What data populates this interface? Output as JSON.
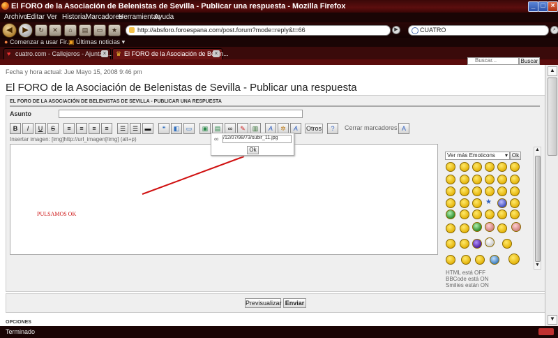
{
  "window": {
    "title": "El FORO de la Asociación de Belenistas de Sevilla - Publicar una respuesta - Mozilla Firefox",
    "controls": [
      "_",
      "□",
      "×"
    ]
  },
  "menu": [
    "Archivo",
    "Editar",
    "Ver",
    "Historial",
    "Marcadores",
    "Herramientas",
    "Ayuda"
  ],
  "nav": {
    "url": "http://absforo.foroespana.com/post.forum?mode=reply&t=66",
    "search_value": "CUATRO"
  },
  "bookmarks": [
    "Comenzar a usar Fir...",
    "Últimas noticias"
  ],
  "tabs": [
    {
      "label": "cuatro.com - Callejeros - Ajuntam...",
      "active": false
    },
    {
      "label": "El FORO de la Asociación de Belen...",
      "active": true
    }
  ],
  "page": {
    "search_placeholder": "Buscar...",
    "search_button": "Buscar",
    "date_line": "Fecha y hora actual: Jue Mayo 15, 2008 9:46 pm",
    "heading": "El FORO de la Asociación de Belenistas de Sevilla - Publicar una respuesta",
    "panel_header": "EL FORO DE LA ASOCIACIÓN DE BELENISTAS DE SEVILLA - PUBLICAR UNA RESPUESTA",
    "subject_label": "Asunto",
    "toolbar": {
      "bold": "B",
      "italic": "I",
      "underline": "U",
      "strike": "S",
      "others_button": "Otros",
      "close_tags": "Cerrar marcadores"
    },
    "insert_image_hint": "Insertar imagen: [img]http://url_imagen[/img] (alt+p)",
    "popup": {
      "value": "/12/07/98/73/subir_11.jpg",
      "ok": "Ok"
    },
    "annotation": "PULSAMOS OK",
    "emoticons": {
      "select": "Ver más Emoticons",
      "ok": "Ok"
    },
    "status": [
      "HTML está OFF",
      "BBCode está ON",
      "Smilies están ON"
    ],
    "buttons": {
      "preview": "Previsualizar",
      "send": "Enviar"
    },
    "options_label": "OPCIONES"
  },
  "statusbar": "Terminado"
}
